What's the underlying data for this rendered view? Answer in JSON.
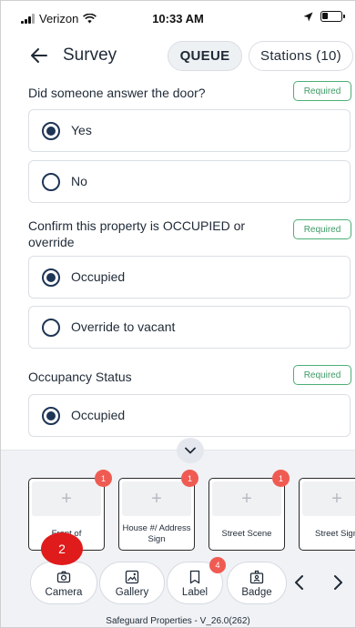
{
  "status_bar": {
    "carrier": "Verizon",
    "time": "10:33 AM"
  },
  "header": {
    "title": "Survey",
    "queue_label": "QUEUE",
    "stations_label": "Stations (10)"
  },
  "questions": [
    {
      "text": "Did someone answer the door?",
      "required_label": "Required",
      "options": [
        {
          "label": "Yes",
          "selected": true
        },
        {
          "label": "No",
          "selected": false
        }
      ]
    },
    {
      "text": "Confirm this property is OCCUPIED or override",
      "required_label": "Required",
      "options": [
        {
          "label": "Occupied",
          "selected": true
        },
        {
          "label": "Override to vacant",
          "selected": false
        }
      ]
    },
    {
      "text": "Occupancy Status",
      "required_label": "Required",
      "options": [
        {
          "label": "Occupied",
          "selected": true
        }
      ]
    }
  ],
  "photo_cards": [
    {
      "label": "Front of",
      "badge": "1"
    },
    {
      "label": "House #/ Address Sign",
      "badge": "1"
    },
    {
      "label": "Street Scene",
      "badge": "1"
    },
    {
      "label": "Street Sign",
      "badge": ""
    }
  ],
  "overlay_badge": "2",
  "toolbar": [
    {
      "label": "Camera",
      "icon": "camera-icon",
      "badge": ""
    },
    {
      "label": "Gallery",
      "icon": "gallery-icon",
      "badge": ""
    },
    {
      "label": "Label",
      "icon": "label-icon",
      "badge": "4"
    },
    {
      "label": "Badge",
      "icon": "badge-icon",
      "badge": ""
    }
  ],
  "footer": "Safeguard Properties - V_26.0(262)",
  "colors": {
    "radio": "#1e3556",
    "required": "#3e9a66",
    "notification_badge": "#ef5b52",
    "panel_bg": "#f0f2f5"
  }
}
